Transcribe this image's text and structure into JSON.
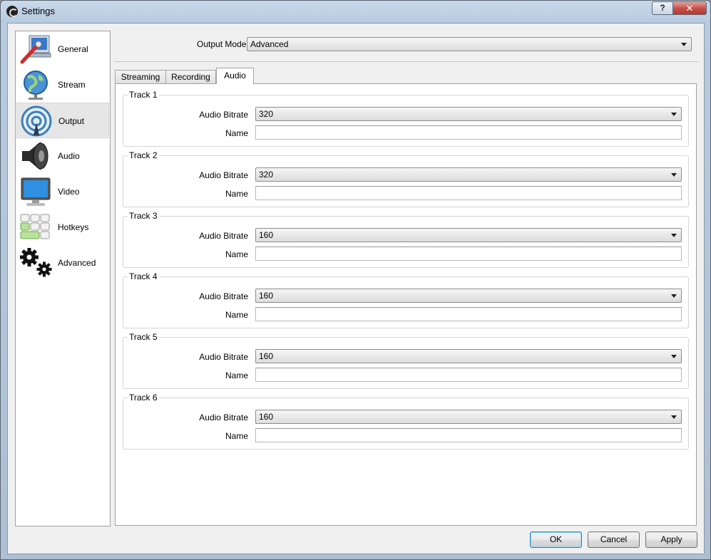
{
  "window": {
    "title": "Settings",
    "help_label": "?",
    "close_label": "✕"
  },
  "sidebar": {
    "items": [
      {
        "label": "General",
        "icon": "general-icon"
      },
      {
        "label": "Stream",
        "icon": "globe-icon"
      },
      {
        "label": "Output",
        "icon": "broadcast-icon",
        "active": true
      },
      {
        "label": "Audio",
        "icon": "speaker-icon"
      },
      {
        "label": "Video",
        "icon": "monitor-icon"
      },
      {
        "label": "Hotkeys",
        "icon": "keyboard-icon"
      },
      {
        "label": "Advanced",
        "icon": "gears-icon"
      }
    ]
  },
  "output_mode": {
    "label": "Output Mode",
    "value": "Advanced"
  },
  "tabs": [
    {
      "label": "Streaming"
    },
    {
      "label": "Recording"
    },
    {
      "label": "Audio",
      "active": true
    }
  ],
  "tracks": [
    {
      "title": "Track 1",
      "bitrate_label": "Audio Bitrate",
      "bitrate": "320",
      "name_label": "Name",
      "name": ""
    },
    {
      "title": "Track 2",
      "bitrate_label": "Audio Bitrate",
      "bitrate": "320",
      "name_label": "Name",
      "name": ""
    },
    {
      "title": "Track 3",
      "bitrate_label": "Audio Bitrate",
      "bitrate": "160",
      "name_label": "Name",
      "name": ""
    },
    {
      "title": "Track 4",
      "bitrate_label": "Audio Bitrate",
      "bitrate": "160",
      "name_label": "Name",
      "name": ""
    },
    {
      "title": "Track 5",
      "bitrate_label": "Audio Bitrate",
      "bitrate": "160",
      "name_label": "Name",
      "name": ""
    },
    {
      "title": "Track 6",
      "bitrate_label": "Audio Bitrate",
      "bitrate": "160",
      "name_label": "Name",
      "name": ""
    }
  ],
  "buttons": {
    "ok": "OK",
    "cancel": "Cancel",
    "apply": "Apply"
  },
  "colors": {
    "close": "#c75050",
    "default_button_border": "#3c7fb1"
  }
}
